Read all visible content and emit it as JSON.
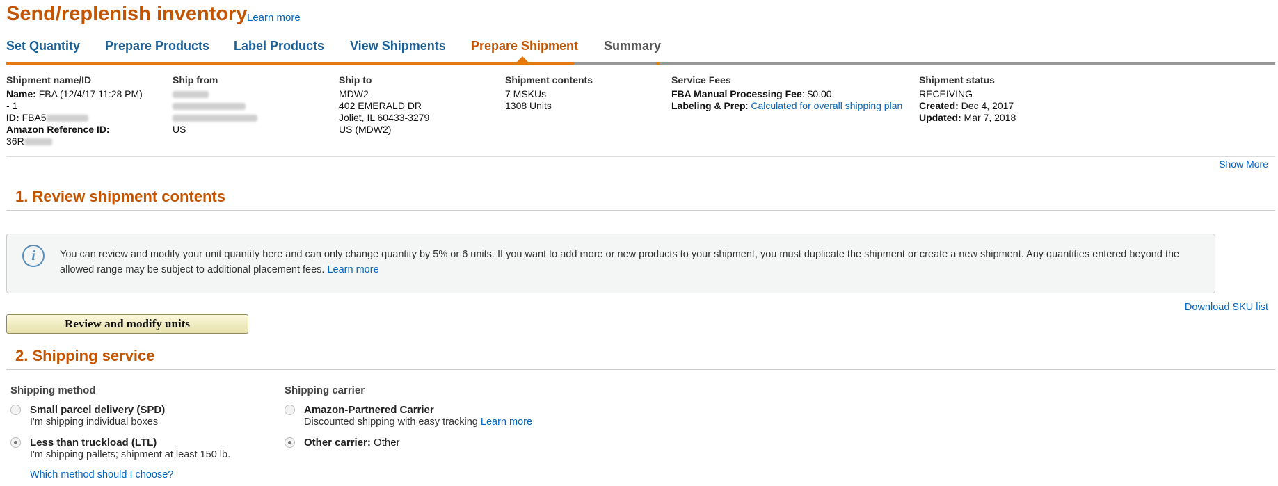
{
  "header": {
    "title": "Send/replenish inventory",
    "learn_more": "Learn more"
  },
  "tabs": [
    {
      "label": "Set Quantity",
      "state": "done"
    },
    {
      "label": "Prepare Products",
      "state": "done"
    },
    {
      "label": "Label Products",
      "state": "done"
    },
    {
      "label": "View Shipments",
      "state": "done"
    },
    {
      "label": "Prepare Shipment",
      "state": "active"
    },
    {
      "label": "Summary",
      "state": "todo"
    }
  ],
  "summary": {
    "name_id": {
      "heading": "Shipment name/ID",
      "name_label": "Name:",
      "name_value": "FBA (12/4/17 11:28 PM) - 1",
      "id_label": "ID:",
      "id_value": "FBA5",
      "ref_label": "Amazon Reference ID:",
      "ref_value": "36R"
    },
    "ship_from": {
      "heading": "Ship from",
      "country": "US"
    },
    "ship_to": {
      "heading": "Ship to",
      "lines": [
        "MDW2",
        "402 EMERALD DR",
        "Joliet, IL 60433-3279",
        "US (MDW2)"
      ]
    },
    "contents": {
      "heading": "Shipment contents",
      "lines": [
        "7 MSKUs",
        "1308 Units"
      ]
    },
    "fees": {
      "heading": "Service Fees",
      "processing_label": "FBA Manual Processing Fee",
      "processing_value": ": $0.00",
      "labeling_label": "Labeling & Prep",
      "labeling_sep": ": ",
      "labeling_link": "Calculated for overall shipping plan"
    },
    "status": {
      "heading": "Shipment status",
      "value": "RECEIVING",
      "created_label": "Created:",
      "created_value": " Dec 4, 2017",
      "updated_label": "Updated:",
      "updated_value": " Mar 7, 2018"
    },
    "show_more": "Show More"
  },
  "section1": {
    "title": "1. Review shipment contents",
    "info_text": "You can review and modify your unit quantity here and can only change quantity by 5% or 6 units. If you want to add more or new products to your shipment, you must duplicate the shipment or create a new shipment. Any quantities entered beyond the allowed range may be subject to additional placement fees. ",
    "info_link": "Learn more",
    "download_sku": "Download SKU list",
    "review_button": "Review and modify units"
  },
  "section2": {
    "title": "2. Shipping service",
    "method_heading": "Shipping method",
    "methods": [
      {
        "title": "Small parcel delivery (SPD)",
        "sub": "I'm shipping individual boxes",
        "checked": false
      },
      {
        "title": "Less than truckload (LTL)",
        "sub": "I'm shipping pallets; shipment at least 150 lb.",
        "checked": true
      }
    ],
    "method_help": "Which method should I choose?",
    "carrier_heading": "Shipping carrier",
    "carriers": [
      {
        "title": "Amazon-Partnered Carrier",
        "sub": "Discounted shipping with easy tracking ",
        "sub_link": "Learn more",
        "checked": false
      },
      {
        "title": "Other carrier:",
        "value": " Other",
        "checked": true
      }
    ]
  },
  "colors": {
    "accent": "#c45500",
    "link": "#0066c0",
    "tab": "#1a5f96",
    "progress": "#e47911"
  }
}
